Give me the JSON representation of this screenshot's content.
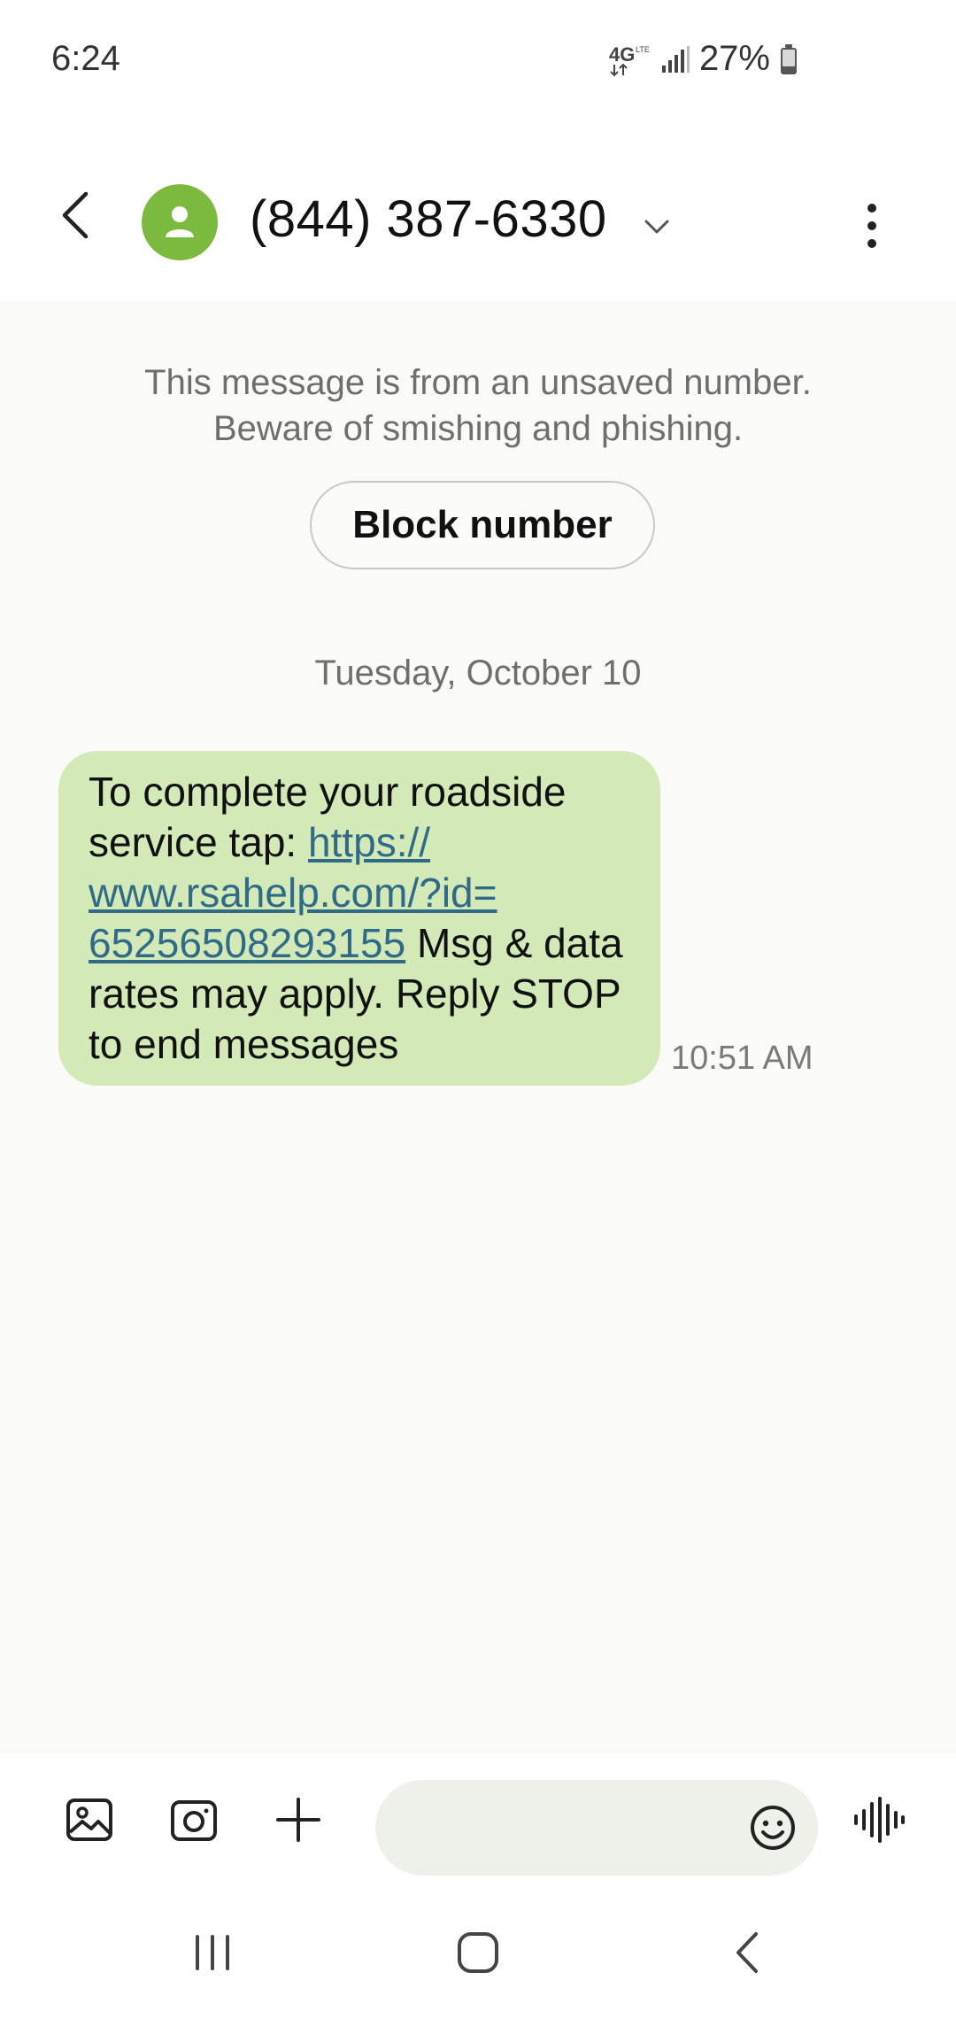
{
  "status_bar": {
    "time": "6:24",
    "network": "4G",
    "battery": "27%",
    "battery_level": 0.27
  },
  "header": {
    "contact": "(844) 387-6330",
    "avatar_color": "#7cba3f",
    "icons": [
      "back-icon",
      "person-icon",
      "chevron-down-icon",
      "more-vert-icon"
    ]
  },
  "conversation": {
    "warning_line1": "This message is from an unsaved number.",
    "warning_line2": "Beware of smishing and phishing.",
    "block_label": "Block number",
    "date": "Tuesday, October 10",
    "messages": [
      {
        "text_before": "To complete your roadside service tap: ",
        "link_line1": "https://",
        "link_line2": "www.rsahelp.com/?id=",
        "link_line3": "65256508293155",
        "text_after": " Msg & data rates may apply. Reply STOP to end messages",
        "time": "10:51 AM",
        "bubble_color": "#d3e9b8"
      }
    ]
  },
  "compose": {
    "placeholder": "",
    "icons": [
      "gallery-icon",
      "camera-icon",
      "plus-icon",
      "emoji-icon",
      "voice-icon"
    ]
  },
  "nav": {
    "icons": [
      "recents-icon",
      "home-icon",
      "back-nav-icon"
    ]
  }
}
